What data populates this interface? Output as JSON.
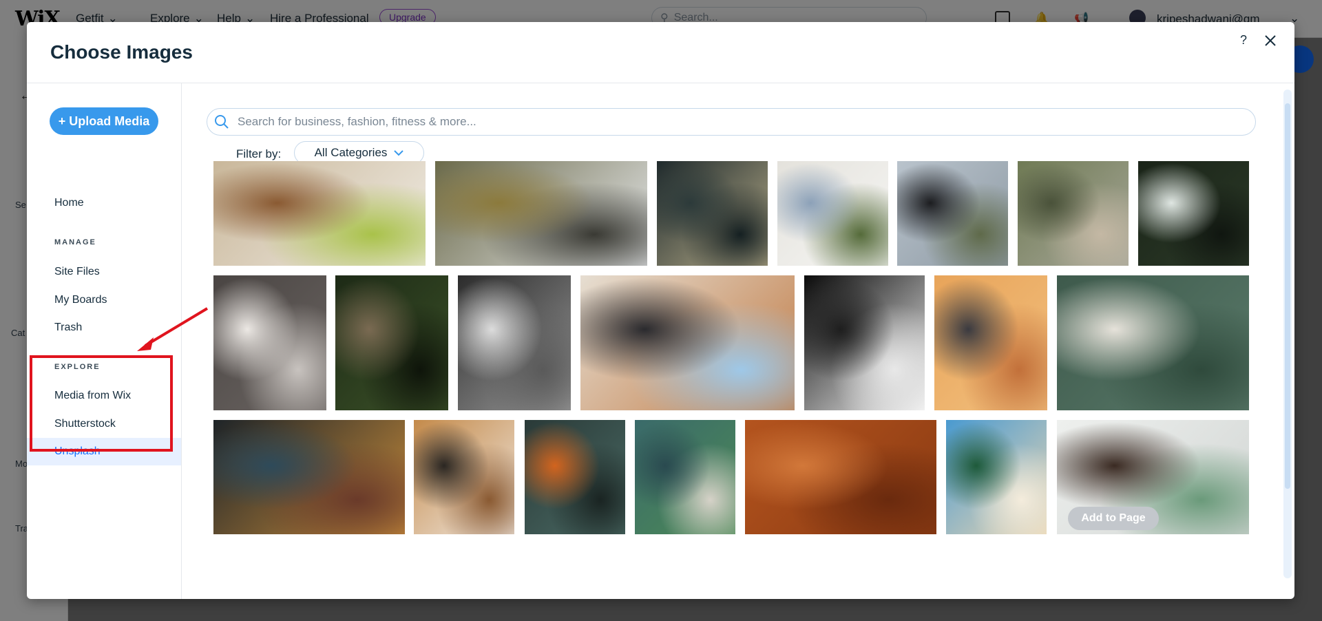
{
  "background": {
    "logo": "WiX",
    "site_name": "Getfit",
    "menu": [
      "Explore",
      "Help",
      "Hire a Professional"
    ],
    "upgrade_label": "Upgrade",
    "search_placeholder": "Search...",
    "user_email": "kripeshadwani@gm",
    "left_labels": [
      "Se",
      "Cat",
      "Mo",
      "Tra"
    ]
  },
  "modal": {
    "title": "Choose Images",
    "help_label": "?",
    "upload_label": "+ Upload Media",
    "side_items": {
      "home": "Home",
      "manage_head": "MANAGE",
      "site_files": "Site Files",
      "my_boards": "My Boards",
      "trash": "Trash",
      "explore_head": "EXPLORE",
      "media_from_wix": "Media from Wix",
      "shutterstock": "Shutterstock",
      "unsplash": "Unsplash"
    },
    "search_placeholder": "Search for business, fashion, fitness & more...",
    "filter_label": "Filter by:",
    "filter_value": "All Categories",
    "add_to_page": "Add to Page"
  },
  "images": [
    {
      "name": "image-desk-tablet",
      "colors": [
        "#c9b79a",
        "#f0ece4",
        "#8a5a32",
        "#a9c24a"
      ]
    },
    {
      "name": "image-waterfall",
      "colors": [
        "#6b6a4a",
        "#e6e8ea",
        "#8c7a3c",
        "#3a3a34"
      ]
    },
    {
      "name": "image-aerial-island",
      "colors": [
        "#1f2a2c",
        "#b7ad8a",
        "#2c3a3a",
        "#152022"
      ]
    },
    {
      "name": "image-people-walking",
      "colors": [
        "#e4e2dc",
        "#f6f6f4",
        "#8ca1b8",
        "#556b3a"
      ]
    },
    {
      "name": "image-black-church",
      "colors": [
        "#b9c3cc",
        "#8e9aa4",
        "#1c1d20",
        "#5f6a4a"
      ]
    },
    {
      "name": "image-picnic",
      "colors": [
        "#6f7a54",
        "#a8a89a",
        "#4a523a",
        "#c4b8a4"
      ]
    },
    {
      "name": "image-dark-waterfall",
      "colors": [
        "#1a2418",
        "#2c3a28",
        "#dfe6e2",
        "#101610"
      ]
    },
    {
      "name": "image-bride",
      "colors": [
        "#4a4543",
        "#6b6562",
        "#ece8e4",
        "#c8c3bf"
      ]
    },
    {
      "name": "image-forest-bridge",
      "colors": [
        "#1d2a16",
        "#3c5228",
        "#7a6a52",
        "#0e140a"
      ]
    },
    {
      "name": "image-man-flowers",
      "colors": [
        "#2c2c2c",
        "#9a9a9a",
        "#dcdcdc",
        "#5a5a5a"
      ]
    },
    {
      "name": "image-laptop-desk",
      "colors": [
        "#e6ded2",
        "#c07a44",
        "#2a2a2e",
        "#9ec8e8"
      ]
    },
    {
      "name": "image-abstract-bw",
      "colors": [
        "#0a0a0a",
        "#f4f4f4",
        "#1e1e1e",
        "#e8e8e8"
      ]
    },
    {
      "name": "image-sunset-kite",
      "colors": [
        "#e8a45a",
        "#f2c07e",
        "#3a3a40",
        "#c2703a"
      ]
    },
    {
      "name": "image-green-room",
      "colors": [
        "#3e5a4c",
        "#5a7a6a",
        "#e6e2da",
        "#2f4a3c"
      ]
    },
    {
      "name": "image-japan-alley",
      "colors": [
        "#1e2428",
        "#c58a3a",
        "#2e4a5a",
        "#6a3a2a"
      ]
    },
    {
      "name": "image-woman-laptop",
      "colors": [
        "#c48a4a",
        "#f0e8e0",
        "#2a2622",
        "#8a5a32"
      ]
    },
    {
      "name": "image-pumpkin",
      "colors": [
        "#2a3a38",
        "#4a6a64",
        "#d2641e",
        "#1a2422"
      ]
    },
    {
      "name": "image-aerial-coast",
      "colors": [
        "#3a6a6a",
        "#4c8a56",
        "#2a4a50",
        "#d6d2c8"
      ]
    },
    {
      "name": "image-orange-texture",
      "colors": [
        "#b4541e",
        "#8a3a12",
        "#d2783a",
        "#6a2a0e"
      ]
    },
    {
      "name": "image-beach-palms",
      "colors": [
        "#4a9ad0",
        "#e8d6b4",
        "#1e5a3a",
        "#f4ecdc"
      ]
    },
    {
      "name": "image-overhead-laptop",
      "colors": [
        "#eef0ee",
        "#d2d6d4",
        "#3a2a22",
        "#6a9a7a"
      ]
    }
  ]
}
